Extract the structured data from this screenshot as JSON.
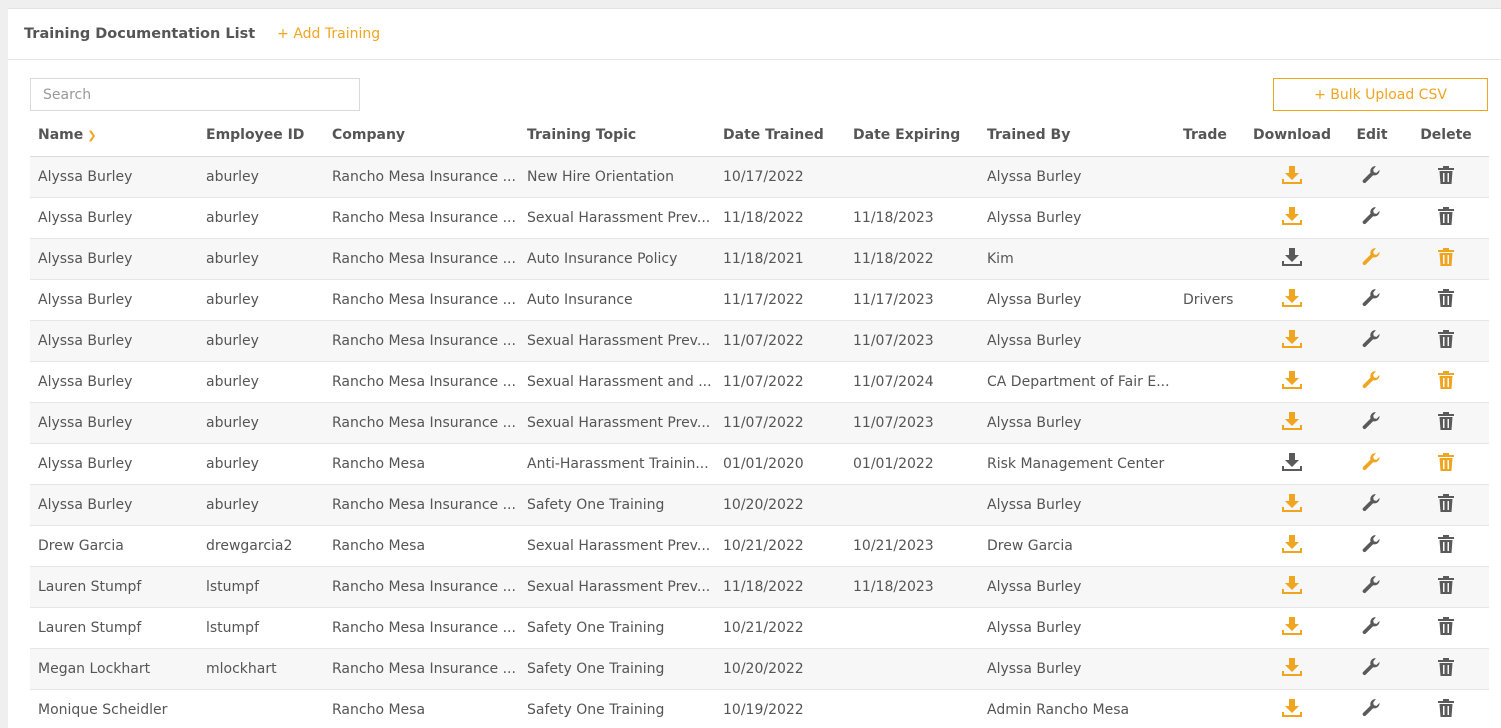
{
  "header": {
    "title": "Training Documentation List",
    "add_label": "+ Add Training"
  },
  "search": {
    "placeholder": "Search",
    "value": ""
  },
  "bulk_upload_label": "+ Bulk Upload CSV",
  "colors": {
    "accent": "#efa520",
    "icon_default": "#5a5a5a"
  },
  "columns": [
    "Name",
    "Employee ID",
    "Company",
    "Training Topic",
    "Date Trained",
    "Date Expiring",
    "Trained By",
    "Trade",
    "Download",
    "Edit",
    "Delete"
  ],
  "sort": {
    "column": "Name",
    "icon": "chevron-down-icon"
  },
  "rows": [
    {
      "name": "Alyssa Burley",
      "employee_id": "aburley",
      "company": "Rancho Mesa Insurance ...",
      "topic": "New Hire Orientation",
      "date_trained": "10/17/2022",
      "date_expiring": "",
      "trained_by": "Alyssa Burley",
      "trade": "",
      "download_color": "#efa520",
      "edit_color": "#5a5a5a",
      "delete_color": "#5a5a5a"
    },
    {
      "name": "Alyssa Burley",
      "employee_id": "aburley",
      "company": "Rancho Mesa Insurance ...",
      "topic": "Sexual Harassment Prev...",
      "date_trained": "11/18/2022",
      "date_expiring": "11/18/2023",
      "trained_by": "Alyssa Burley",
      "trade": "",
      "download_color": "#efa520",
      "edit_color": "#5a5a5a",
      "delete_color": "#5a5a5a"
    },
    {
      "name": "Alyssa Burley",
      "employee_id": "aburley",
      "company": "Rancho Mesa Insurance ...",
      "topic": "Auto Insurance Policy",
      "date_trained": "11/18/2021",
      "date_expiring": "11/18/2022",
      "trained_by": "Kim",
      "trade": "",
      "download_color": "#5a5a5a",
      "edit_color": "#efa520",
      "delete_color": "#efa520"
    },
    {
      "name": "Alyssa Burley",
      "employee_id": "aburley",
      "company": "Rancho Mesa Insurance ...",
      "topic": "Auto Insurance",
      "date_trained": "11/17/2022",
      "date_expiring": "11/17/2023",
      "trained_by": "Alyssa Burley",
      "trade": "Drivers",
      "download_color": "#efa520",
      "edit_color": "#5a5a5a",
      "delete_color": "#5a5a5a"
    },
    {
      "name": "Alyssa Burley",
      "employee_id": "aburley",
      "company": "Rancho Mesa Insurance ...",
      "topic": "Sexual Harassment Prev...",
      "date_trained": "11/07/2022",
      "date_expiring": "11/07/2023",
      "trained_by": "Alyssa Burley",
      "trade": "",
      "download_color": "#efa520",
      "edit_color": "#5a5a5a",
      "delete_color": "#5a5a5a"
    },
    {
      "name": "Alyssa Burley",
      "employee_id": "aburley",
      "company": "Rancho Mesa Insurance ...",
      "topic": "Sexual Harassment and ...",
      "date_trained": "11/07/2022",
      "date_expiring": "11/07/2024",
      "trained_by": "CA Department of Fair E...",
      "trade": "",
      "download_color": "#efa520",
      "edit_color": "#efa520",
      "delete_color": "#efa520"
    },
    {
      "name": "Alyssa Burley",
      "employee_id": "aburley",
      "company": "Rancho Mesa Insurance ...",
      "topic": "Sexual Harassment Prev...",
      "date_trained": "11/07/2022",
      "date_expiring": "11/07/2023",
      "trained_by": "Alyssa Burley",
      "trade": "",
      "download_color": "#efa520",
      "edit_color": "#5a5a5a",
      "delete_color": "#5a5a5a"
    },
    {
      "name": "Alyssa Burley",
      "employee_id": "aburley",
      "company": "Rancho Mesa",
      "topic": "Anti-Harassment Trainin...",
      "date_trained": "01/01/2020",
      "date_expiring": "01/01/2022",
      "trained_by": "Risk Management Center",
      "trade": "",
      "download_color": "#5a5a5a",
      "edit_color": "#efa520",
      "delete_color": "#efa520"
    },
    {
      "name": "Alyssa Burley",
      "employee_id": "aburley",
      "company": "Rancho Mesa Insurance ...",
      "topic": "Safety One Training",
      "date_trained": "10/20/2022",
      "date_expiring": "",
      "trained_by": "Alyssa Burley",
      "trade": "",
      "download_color": "#efa520",
      "edit_color": "#5a5a5a",
      "delete_color": "#5a5a5a"
    },
    {
      "name": "Drew Garcia",
      "employee_id": "drewgarcia2",
      "company": "Rancho Mesa",
      "topic": "Sexual Harassment Prev...",
      "date_trained": "10/21/2022",
      "date_expiring": "10/21/2023",
      "trained_by": "Drew Garcia",
      "trade": "",
      "download_color": "#efa520",
      "edit_color": "#5a5a5a",
      "delete_color": "#5a5a5a"
    },
    {
      "name": "Lauren Stumpf",
      "employee_id": "lstumpf",
      "company": "Rancho Mesa Insurance ...",
      "topic": "Sexual Harassment Prev...",
      "date_trained": "11/18/2022",
      "date_expiring": "11/18/2023",
      "trained_by": "Alyssa Burley",
      "trade": "",
      "download_color": "#efa520",
      "edit_color": "#5a5a5a",
      "delete_color": "#5a5a5a"
    },
    {
      "name": "Lauren Stumpf",
      "employee_id": "lstumpf",
      "company": "Rancho Mesa Insurance ...",
      "topic": "Safety One Training",
      "date_trained": "10/21/2022",
      "date_expiring": "",
      "trained_by": "Alyssa Burley",
      "trade": "",
      "download_color": "#efa520",
      "edit_color": "#5a5a5a",
      "delete_color": "#5a5a5a"
    },
    {
      "name": "Megan Lockhart",
      "employee_id": "mlockhart",
      "company": "Rancho Mesa Insurance ...",
      "topic": "Safety One Training",
      "date_trained": "10/20/2022",
      "date_expiring": "",
      "trained_by": "Alyssa Burley",
      "trade": "",
      "download_color": "#efa520",
      "edit_color": "#5a5a5a",
      "delete_color": "#5a5a5a"
    },
    {
      "name": "Monique Scheidler",
      "employee_id": "",
      "company": "Rancho Mesa",
      "topic": "Safety One Training",
      "date_trained": "10/19/2022",
      "date_expiring": "",
      "trained_by": "Admin Rancho Mesa",
      "trade": "",
      "download_color": "#efa520",
      "edit_color": "#5a5a5a",
      "delete_color": "#5a5a5a"
    }
  ]
}
